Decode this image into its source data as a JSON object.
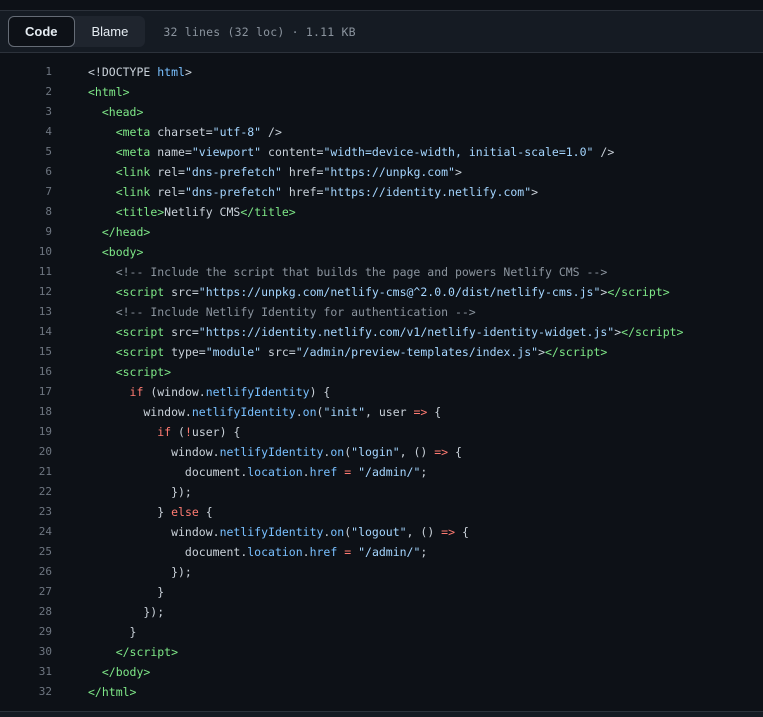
{
  "header": {
    "tabs": [
      {
        "label": "Code",
        "selected": true
      },
      {
        "label": "Blame",
        "selected": false
      }
    ],
    "file_info": "32 lines (32 loc) · 1.11 KB"
  },
  "colors": {
    "page_bg": "#0d1117",
    "header_bg": "#151b23",
    "border": "#2c323b",
    "tag_green": "#7ee787",
    "string_blue": "#a5d6ff",
    "keyword_red": "#ff7b72",
    "constant_blue": "#79c0ff",
    "comment_gray": "#8b949e",
    "plain_text": "#c9d1d9",
    "line_number": "#6e7681"
  },
  "code": {
    "lines": [
      {
        "n": "1",
        "tokens": [
          [
            "p",
            "<!DOCTYPE "
          ],
          [
            "c",
            "html"
          ],
          [
            "p",
            ">"
          ]
        ]
      },
      {
        "n": "2",
        "tokens": [
          [
            "t",
            "<html>"
          ]
        ]
      },
      {
        "n": "3",
        "tokens": [
          [
            "p",
            "  "
          ],
          [
            "t",
            "<head>"
          ]
        ]
      },
      {
        "n": "4",
        "tokens": [
          [
            "p",
            "    "
          ],
          [
            "t",
            "<meta"
          ],
          [
            "p",
            " charset="
          ],
          [
            "s",
            "\"utf-8\""
          ],
          [
            "p",
            " />"
          ]
        ]
      },
      {
        "n": "5",
        "tokens": [
          [
            "p",
            "    "
          ],
          [
            "t",
            "<meta"
          ],
          [
            "p",
            " name="
          ],
          [
            "s",
            "\"viewport\""
          ],
          [
            "p",
            " content="
          ],
          [
            "s",
            "\"width=device-width, initial-scale=1.0\""
          ],
          [
            "p",
            " />"
          ]
        ]
      },
      {
        "n": "6",
        "tokens": [
          [
            "p",
            "    "
          ],
          [
            "t",
            "<link"
          ],
          [
            "p",
            " rel="
          ],
          [
            "s",
            "\"dns-prefetch\""
          ],
          [
            "p",
            " href="
          ],
          [
            "s",
            "\"https://unpkg.com\""
          ],
          [
            "p",
            ">"
          ]
        ]
      },
      {
        "n": "7",
        "tokens": [
          [
            "p",
            "    "
          ],
          [
            "t",
            "<link"
          ],
          [
            "p",
            " rel="
          ],
          [
            "s",
            "\"dns-prefetch\""
          ],
          [
            "p",
            " href="
          ],
          [
            "s",
            "\"https://identity.netlify.com\""
          ],
          [
            "p",
            ">"
          ]
        ]
      },
      {
        "n": "8",
        "tokens": [
          [
            "p",
            "    "
          ],
          [
            "t",
            "<title>"
          ],
          [
            "p",
            "Netlify CMS"
          ],
          [
            "t",
            "</title>"
          ]
        ]
      },
      {
        "n": "9",
        "tokens": [
          [
            "p",
            "  "
          ],
          [
            "t",
            "</head>"
          ]
        ]
      },
      {
        "n": "10",
        "tokens": [
          [
            "p",
            "  "
          ],
          [
            "t",
            "<body>"
          ]
        ]
      },
      {
        "n": "11",
        "tokens": [
          [
            "p",
            "    "
          ],
          [
            "m",
            "<!-- Include the script that builds the page and powers Netlify CMS -->"
          ]
        ]
      },
      {
        "n": "12",
        "tokens": [
          [
            "p",
            "    "
          ],
          [
            "t",
            "<script"
          ],
          [
            "p",
            " src="
          ],
          [
            "s",
            "\"https://unpkg.com/netlify-cms@^2.0.0/dist/netlify-cms.js\""
          ],
          [
            "p",
            ">"
          ],
          [
            "t",
            "</script>"
          ]
        ]
      },
      {
        "n": "13",
        "tokens": [
          [
            "p",
            "    "
          ],
          [
            "m",
            "<!-- Include Netlify Identity for authentication -->"
          ]
        ]
      },
      {
        "n": "14",
        "tokens": [
          [
            "p",
            "    "
          ],
          [
            "t",
            "<script"
          ],
          [
            "p",
            " src="
          ],
          [
            "s",
            "\"https://identity.netlify.com/v1/netlify-identity-widget.js\""
          ],
          [
            "p",
            ">"
          ],
          [
            "t",
            "</script>"
          ]
        ]
      },
      {
        "n": "15",
        "tokens": [
          [
            "p",
            "    "
          ],
          [
            "t",
            "<script"
          ],
          [
            "p",
            " type="
          ],
          [
            "s",
            "\"module\""
          ],
          [
            "p",
            " src="
          ],
          [
            "s",
            "\"/admin/preview-templates/index.js\""
          ],
          [
            "p",
            ">"
          ],
          [
            "t",
            "</script>"
          ]
        ]
      },
      {
        "n": "16",
        "tokens": [
          [
            "p",
            "    "
          ],
          [
            "t",
            "<script>"
          ]
        ]
      },
      {
        "n": "17",
        "tokens": [
          [
            "p",
            "      "
          ],
          [
            "k",
            "if"
          ],
          [
            "p",
            " (window."
          ],
          [
            "c",
            "netlifyIdentity"
          ],
          [
            "p",
            ") {"
          ]
        ]
      },
      {
        "n": "18",
        "tokens": [
          [
            "p",
            "        window."
          ],
          [
            "c",
            "netlifyIdentity"
          ],
          [
            "p",
            "."
          ],
          [
            "c",
            "on"
          ],
          [
            "p",
            "("
          ],
          [
            "s",
            "\"init\""
          ],
          [
            "p",
            ", user "
          ],
          [
            "k",
            "=>"
          ],
          [
            "p",
            " {"
          ]
        ]
      },
      {
        "n": "19",
        "tokens": [
          [
            "p",
            "          "
          ],
          [
            "k",
            "if"
          ],
          [
            "p",
            " ("
          ],
          [
            "k",
            "!"
          ],
          [
            "p",
            "user) {"
          ]
        ]
      },
      {
        "n": "20",
        "tokens": [
          [
            "p",
            "            window."
          ],
          [
            "c",
            "netlifyIdentity"
          ],
          [
            "p",
            "."
          ],
          [
            "c",
            "on"
          ],
          [
            "p",
            "("
          ],
          [
            "s",
            "\"login\""
          ],
          [
            "p",
            ", () "
          ],
          [
            "k",
            "=>"
          ],
          [
            "p",
            " {"
          ]
        ]
      },
      {
        "n": "21",
        "tokens": [
          [
            "p",
            "              document."
          ],
          [
            "c",
            "location"
          ],
          [
            "p",
            "."
          ],
          [
            "c",
            "href"
          ],
          [
            "p",
            " "
          ],
          [
            "k",
            "="
          ],
          [
            "p",
            " "
          ],
          [
            "s",
            "\"/admin/\""
          ],
          [
            "p",
            ";"
          ]
        ]
      },
      {
        "n": "22",
        "tokens": [
          [
            "p",
            "            });"
          ]
        ]
      },
      {
        "n": "23",
        "tokens": [
          [
            "p",
            "          } "
          ],
          [
            "k",
            "else"
          ],
          [
            "p",
            " {"
          ]
        ]
      },
      {
        "n": "24",
        "tokens": [
          [
            "p",
            "            window."
          ],
          [
            "c",
            "netlifyIdentity"
          ],
          [
            "p",
            "."
          ],
          [
            "c",
            "on"
          ],
          [
            "p",
            "("
          ],
          [
            "s",
            "\"logout\""
          ],
          [
            "p",
            ", () "
          ],
          [
            "k",
            "=>"
          ],
          [
            "p",
            " {"
          ]
        ]
      },
      {
        "n": "25",
        "tokens": [
          [
            "p",
            "              document."
          ],
          [
            "c",
            "location"
          ],
          [
            "p",
            "."
          ],
          [
            "c",
            "href"
          ],
          [
            "p",
            " "
          ],
          [
            "k",
            "="
          ],
          [
            "p",
            " "
          ],
          [
            "s",
            "\"/admin/\""
          ],
          [
            "p",
            ";"
          ]
        ]
      },
      {
        "n": "26",
        "tokens": [
          [
            "p",
            "            });"
          ]
        ]
      },
      {
        "n": "27",
        "tokens": [
          [
            "p",
            "          }"
          ]
        ]
      },
      {
        "n": "28",
        "tokens": [
          [
            "p",
            "        });"
          ]
        ]
      },
      {
        "n": "29",
        "tokens": [
          [
            "p",
            "      }"
          ]
        ]
      },
      {
        "n": "30",
        "tokens": [
          [
            "p",
            "    "
          ],
          [
            "t",
            "</script>"
          ]
        ]
      },
      {
        "n": "31",
        "tokens": [
          [
            "p",
            "  "
          ],
          [
            "t",
            "</body>"
          ]
        ]
      },
      {
        "n": "32",
        "tokens": [
          [
            "t",
            "</html>"
          ]
        ]
      }
    ]
  }
}
